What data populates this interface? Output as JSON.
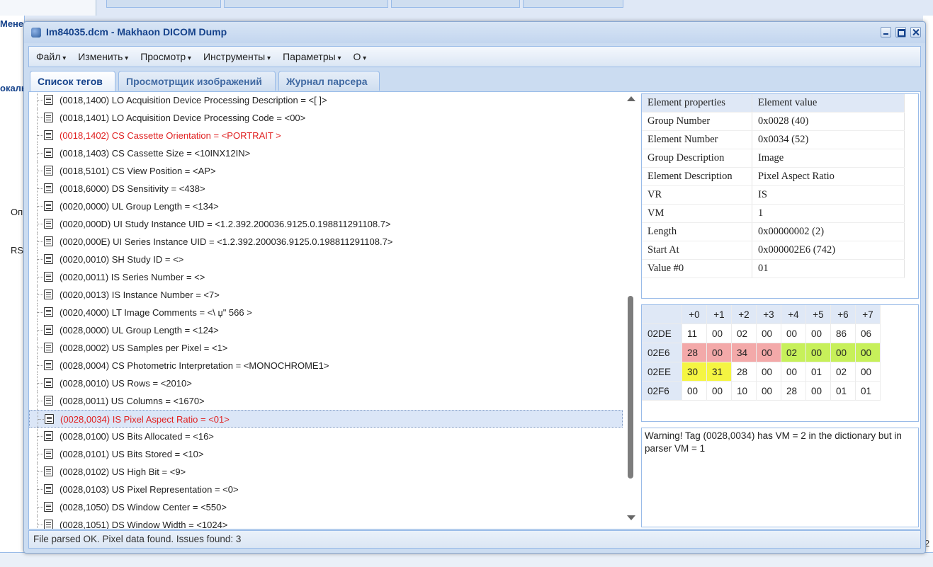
{
  "window": {
    "title": "Im84035.dcm - Makhaon DICOM Dump"
  },
  "background": {
    "fragments": [
      "Мене",
      "окаль",
      "Оп",
      "RS",
      "2"
    ]
  },
  "menu": [
    "Файл",
    "Изменить",
    "Просмотр",
    "Инструменты",
    "Параметры",
    "О"
  ],
  "tabs": [
    "Список тегов",
    "Просмотрщик изображений",
    "Журнал парсера"
  ],
  "tags": [
    {
      "text": "(0018,1400) LO Acquisition Device Processing Description = <[                  ]>",
      "red": false
    },
    {
      "text": "(0018,1401) LO Acquisition Device Processing Code = <00>",
      "red": false
    },
    {
      "text": "(0018,1402) CS Cassette Orientation = <PORTRAIT >",
      "red": true
    },
    {
      "text": "(0018,1403) CS Cassette Size = <10INX12IN>",
      "red": false
    },
    {
      "text": "(0018,5101) CS View Position = <AP>",
      "red": false
    },
    {
      "text": "(0018,6000) DS Sensitivity = <438>",
      "red": false
    },
    {
      "text": "(0020,0000) UL Group Length = <134>",
      "red": false
    },
    {
      "text": "(0020,000D) UI Study Instance UID = <1.2.392.200036.9125.0.198811291108.7>",
      "red": false
    },
    {
      "text": "(0020,000E) UI Series Instance UID = <1.2.392.200036.9125.0.198811291108.7>",
      "red": false
    },
    {
      "text": "(0020,0010) SH Study ID = <>",
      "red": false
    },
    {
      "text": "(0020,0011) IS Series Number = <>",
      "red": false
    },
    {
      "text": "(0020,0013) IS Instance Number = <7>",
      "red": false
    },
    {
      "text": "(0020,4000) LT Image Comments = <\\  џ\"  566 >",
      "red": false
    },
    {
      "text": "(0028,0000) UL Group Length = <124>",
      "red": false
    },
    {
      "text": "(0028,0002) US Samples per Pixel = <1>",
      "red": false
    },
    {
      "text": "(0028,0004) CS Photometric Interpretation = <MONOCHROME1>",
      "red": false
    },
    {
      "text": "(0028,0010) US Rows = <2010>",
      "red": false
    },
    {
      "text": "(0028,0011) US Columns = <1670>",
      "red": false
    },
    {
      "text": "(0028,0034) IS Pixel Aspect Ratio = <01>",
      "red": true,
      "selected": true
    },
    {
      "text": "(0028,0100) US Bits Allocated = <16>",
      "red": false
    },
    {
      "text": "(0028,0101) US Bits Stored = <10>",
      "red": false
    },
    {
      "text": "(0028,0102) US High Bit = <9>",
      "red": false
    },
    {
      "text": "(0028,0103) US Pixel Representation = <0>",
      "red": false
    },
    {
      "text": "(0028,1050) DS Window Center = <550>",
      "red": false
    },
    {
      "text": "(0028,1051) DS Window Width = <1024>",
      "red": false
    }
  ],
  "properties": {
    "headers": [
      "Element properties",
      "Element value"
    ],
    "rows": [
      [
        "Group Number",
        "0x0028 (40)"
      ],
      [
        "Element Number",
        "0x0034 (52)"
      ],
      [
        "Group Description",
        "Image"
      ],
      [
        "Element Description",
        "Pixel Aspect Ratio"
      ],
      [
        "VR",
        "IS"
      ],
      [
        "VM",
        "1"
      ],
      [
        "Length",
        "0x00000002 (2)"
      ],
      [
        "Start At",
        "0x000002E6 (742)"
      ],
      [
        "Value #0",
        "01"
      ]
    ]
  },
  "hex": {
    "columns": [
      "+0",
      "+1",
      "+2",
      "+3",
      "+4",
      "+5",
      "+6",
      "+7"
    ],
    "rows": [
      {
        "addr": "02DE",
        "bytes": [
          "11",
          "00",
          "02",
          "00",
          "00",
          "00",
          "86",
          "06"
        ],
        "hl": [
          "",
          "",
          "",
          "",
          "",
          "",
          "",
          ""
        ]
      },
      {
        "addr": "02E6",
        "bytes": [
          "28",
          "00",
          "34",
          "00",
          "02",
          "00",
          "00",
          "00"
        ],
        "hl": [
          "pink",
          "pink",
          "pink",
          "pink",
          "green",
          "green",
          "green",
          "green"
        ]
      },
      {
        "addr": "02EE",
        "bytes": [
          "30",
          "31",
          "28",
          "00",
          "00",
          "01",
          "02",
          "00"
        ],
        "hl": [
          "yellow",
          "yellow",
          "",
          "",
          "",
          "",
          "",
          ""
        ]
      },
      {
        "addr": "02F6",
        "bytes": [
          "00",
          "00",
          "10",
          "00",
          "28",
          "00",
          "01",
          "01"
        ],
        "hl": [
          "",
          "",
          "",
          "",
          "",
          "",
          "",
          ""
        ]
      }
    ]
  },
  "warning": "Warning! Tag (0028,0034) has VM = 2 in the dictionary but in parser VM = 1",
  "status": "File parsed OK. Pixel data found. Issues found: 3",
  "colors": {
    "accent": "#15428b",
    "highlight_red": "#e02020",
    "pink": "#f3a9a9",
    "green": "#c7f05a",
    "yellow": "#f5f542"
  }
}
